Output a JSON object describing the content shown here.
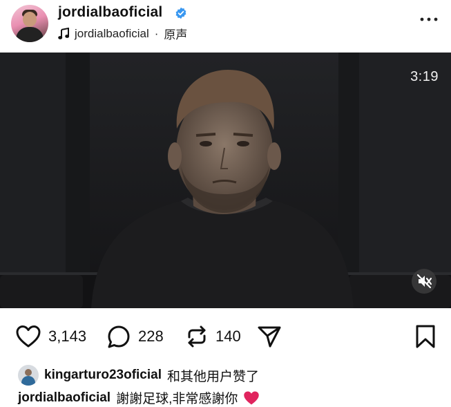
{
  "post": {
    "username": "jordialbaoficial",
    "audio": "jordialbaoficial",
    "audio_separator": "·",
    "audio_type": "原声"
  },
  "video": {
    "duration": "3:19"
  },
  "actions": {
    "likes": "3,143",
    "comments": "228",
    "reposts": "140"
  },
  "liked_by": {
    "user": "kingarturo23oficial",
    "suffix": "和其他用户赞了"
  },
  "caption": {
    "user": "jordialbaoficial",
    "text": "謝謝足球,非常感謝你",
    "emoji": "❤️"
  },
  "colors": {
    "verified": "#3897f0",
    "heart_emoji": "#e0245e"
  }
}
